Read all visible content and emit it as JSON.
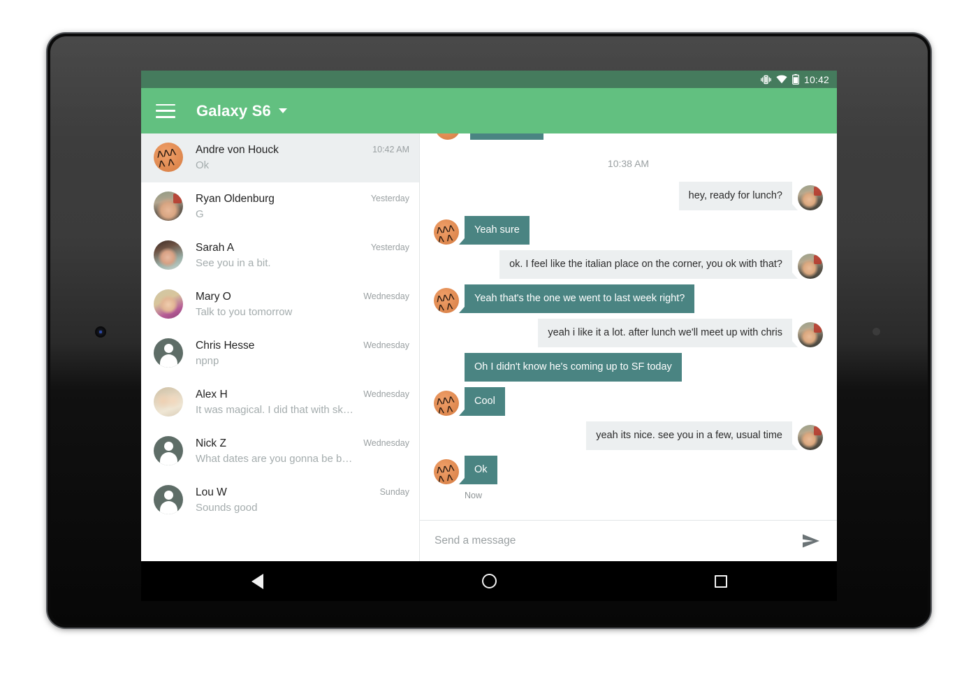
{
  "device": {
    "name": "android-tablet",
    "camera_icon": "front-camera-icon",
    "sensor_icon": "ambient-sensor-icon"
  },
  "status_bar": {
    "time": "10:42",
    "icons": [
      "vibrate-icon",
      "wifi-icon",
      "battery-icon"
    ],
    "background": "#457b5d"
  },
  "app_bar": {
    "menu_icon": "hamburger-menu-icon",
    "title": "Galaxy S6",
    "caret_icon": "chevron-down-icon",
    "background": "#62c080"
  },
  "conversation_list": {
    "items": [
      {
        "name": "Andre von Houck",
        "snippet": "Ok",
        "time": "10:42 AM",
        "avatar": "av-andre",
        "selected": true
      },
      {
        "name": "Ryan Oldenburg",
        "snippet": "G",
        "time": "Yesterday",
        "avatar": "av-ryan",
        "selected": false
      },
      {
        "name": "Sarah A",
        "snippet": "See you in a bit.",
        "time": "Yesterday",
        "avatar": "av-sarah",
        "selected": false
      },
      {
        "name": "Mary O",
        "snippet": "Talk to you tomorrow",
        "time": "Wednesday",
        "avatar": "av-mary",
        "selected": false
      },
      {
        "name": "Chris Hesse",
        "snippet": "npnp",
        "time": "Wednesday",
        "avatar": "av-default",
        "selected": false
      },
      {
        "name": "Alex H",
        "snippet": "It was magical. I did that with skyrim",
        "time": "Wednesday",
        "avatar": "av-alex",
        "selected": false
      },
      {
        "name": "Nick Z",
        "snippet": "What dates are you gonna be back in M…",
        "time": "Wednesday",
        "avatar": "av-default",
        "selected": false
      },
      {
        "name": "Lou W",
        "snippet": "Sounds good",
        "time": "Sunday",
        "avatar": "av-default",
        "selected": false
      }
    ]
  },
  "thread": {
    "time_divider": "10:38 AM",
    "messages": [
      {
        "text": "hey, ready for lunch?",
        "side": "me",
        "avatar": true,
        "tail": true
      },
      {
        "text": "Yeah sure",
        "side": "them",
        "avatar": true,
        "tail": true
      },
      {
        "text": "ok. I feel like the italian place on the corner, you ok with that?",
        "side": "me",
        "avatar": true,
        "tail": true
      },
      {
        "text": "Yeah that's the one we went to last week right?",
        "side": "them",
        "avatar": true,
        "tail": true
      },
      {
        "text": "yeah i like it a lot. after lunch we'll meet up with chris",
        "side": "me",
        "avatar": true,
        "tail": true
      },
      {
        "text": "Oh I didn't know he's coming up to SF today",
        "side": "them",
        "avatar": false,
        "tail": false
      },
      {
        "text": "Cool",
        "side": "them",
        "avatar": true,
        "tail": true
      },
      {
        "text": "yeah its nice. see you in a few, usual time",
        "side": "me",
        "avatar": true,
        "tail": true
      },
      {
        "text": "Ok",
        "side": "them",
        "avatar": true,
        "tail": true
      }
    ],
    "sent_label": "Now",
    "bubble_them_color": "#4a8482",
    "bubble_me_color": "#eceff0"
  },
  "composer": {
    "placeholder": "Send a message",
    "value": "",
    "send_icon": "send-paper-plane-icon"
  },
  "nav_bar": {
    "back": "back-icon",
    "home": "home-icon",
    "recents": "recents-icon"
  }
}
